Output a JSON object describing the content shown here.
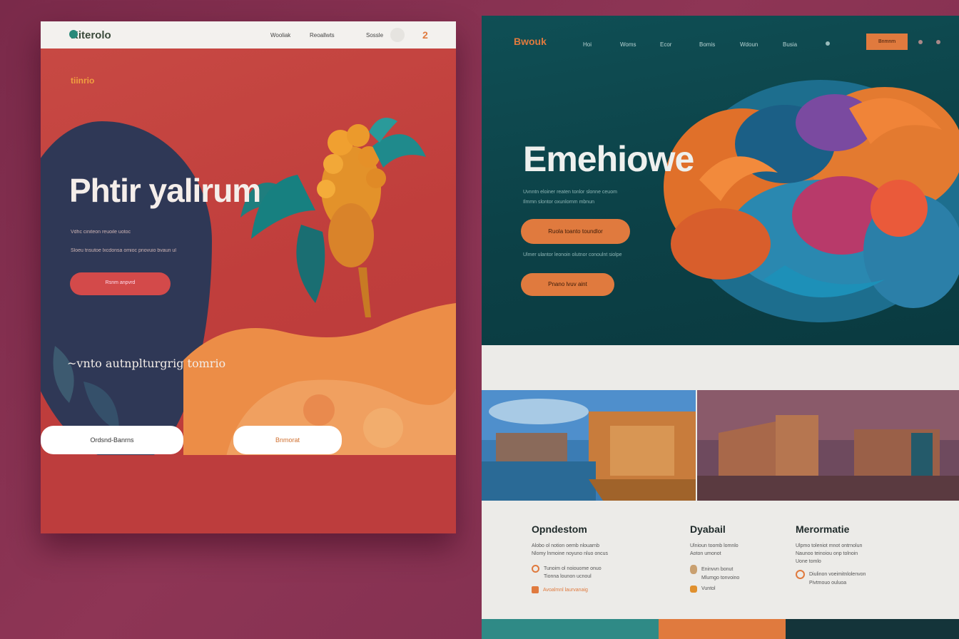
{
  "left": {
    "nav": {
      "logo": "Kiterolo",
      "links": [
        "Wooliak",
        "Reoallwts",
        "Sossle"
      ],
      "badge": "2"
    },
    "brand_small": "tiinrio",
    "hero_title": "Phtir yalirum",
    "subtitle_lines": [
      "Vdhc ciniteon reuoile uotoc",
      "Sloeu tnsutoe lxcdonsa omioc pnovuio bvaun ul"
    ],
    "cta_primary": "Rsnm anpvrd",
    "tagline": "~vnto autnplturgrig tomrio",
    "btn_one": "Ordsnd-Banrns",
    "btn_two": "Bnmorat"
  },
  "right": {
    "nav": {
      "logo": "Bwouk",
      "links": [
        "Hoi",
        "Woms",
        "Ecor",
        "Bomis",
        "Wdoun",
        "Busia"
      ],
      "cta": "Bnmnm"
    },
    "hero_title": "Emehiowe",
    "subtitle_lines": [
      "Uvnntn eloiner reaten tonlor slonne ceuom",
      "Ilmmn slontor oxunlornm mbnun"
    ],
    "btn_one": "Ruola toanto toundlor",
    "note": "Ulmer ulantor leonoin olutnor conoulnt siolpe",
    "btn_two": "Pnano lvuv aint"
  },
  "columns": [
    {
      "title": "Opndestom",
      "text": [
        "Alobo ol notion oemb nlouarnb",
        "Nlomy lnmoine noyuno nluo oncus"
      ],
      "items": [
        "Tunoim ol noiouome onuo",
        "Tionna lounon ucnoul"
      ],
      "link": "Avoalmnl laurvanaig"
    },
    {
      "title": "Dyabail",
      "text": [
        "Ulnioun toomb lomnlo",
        "Aoton umonot"
      ],
      "items": [
        "Eninvvn bonut",
        "Mlumgo tonvoino",
        "Vuntol"
      ]
    },
    {
      "title": "Merormatie",
      "text": [
        "Ulpmo toleniot mnot ontrnolun",
        "Naunoo teinoiou onp tolnoin",
        "Uone tomlo"
      ],
      "items": [
        "Diulinon voeimitnlolenvon",
        "Pivtmouo ouluoa"
      ]
    }
  ],
  "colors": {
    "left_bg": "#c44541",
    "navy": "#2f3856",
    "orange": "#e07a3e",
    "teal_dark": "#0c4147",
    "page_bg": "#832f50"
  }
}
